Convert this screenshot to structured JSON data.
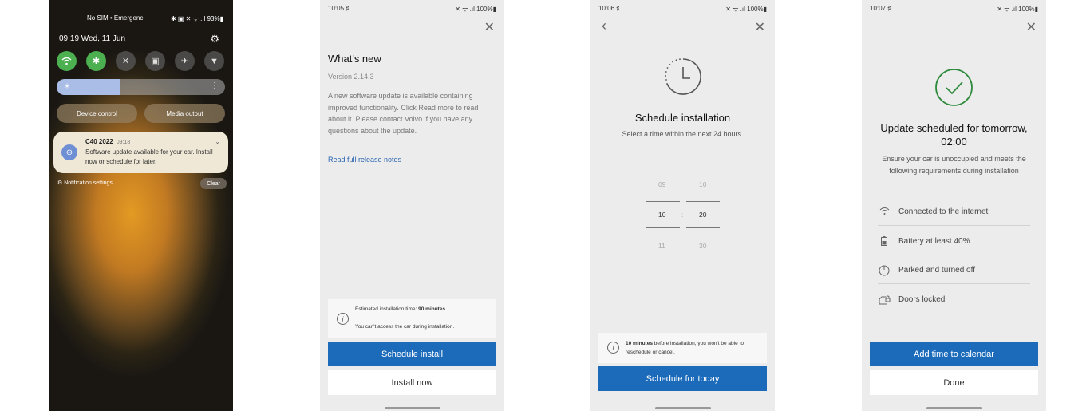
{
  "screen1": {
    "status_left": "No SIM • Emergenc",
    "status_right": "✱ ▣ ✕ ᯤ .ıl 93%▮",
    "datetime": "09:19  Wed, 11 Jun",
    "quick_tiles": [
      "wifi-icon",
      "bluetooth-icon",
      "mute-icon",
      "rotate-icon",
      "airplane-icon",
      "flashlight-icon"
    ],
    "device_control": "Device control",
    "media_output": "Media output",
    "notification": {
      "title": "C40 2022",
      "time": "09:18",
      "body": "Software update available for your car. Install now or schedule for later."
    },
    "notification_settings": "Notification settings",
    "clear": "Clear"
  },
  "screen2": {
    "status_time": "10:05 ♯",
    "status_right": "✕ ᯤ .ıl 100%▮",
    "title": "What's new",
    "version": "Version 2.14.3",
    "body": "A new software update is available containing improved functionality. Click Read more to read about it. Please contact Volvo if you have any questions about the update.",
    "link": "Read full release notes",
    "info_line1_prefix": "Estimated installation time: ",
    "info_line1_bold": "90 minutes",
    "info_line2": "You can't access the car during installation.",
    "primary_button": "Schedule install",
    "secondary_button": "Install now"
  },
  "screen3": {
    "status_time": "10:06 ♯",
    "status_right": "✕ ᯤ .ıl 100%▮",
    "title": "Schedule installation",
    "subtitle": "Select a time within the next 24 hours.",
    "hours": [
      "09",
      "10",
      "11"
    ],
    "minutes": [
      "10",
      "20",
      "30"
    ],
    "separator": ":",
    "info_bold": "10 minutes",
    "info_rest": " before installation, you won't be able to reschedule or cancel.",
    "primary_button": "Schedule for today"
  },
  "screen4": {
    "status_time": "10:07 ♯",
    "status_right": "✕ ᯤ .ıl 100%▮",
    "title_line1": "Update scheduled for tomorrow,",
    "title_line2": "02:00",
    "subtitle": "Ensure your car is unoccupied and meets the following requirements during installation",
    "requirements": [
      {
        "icon": "wifi-icon",
        "label": "Connected to the internet"
      },
      {
        "icon": "battery-icon",
        "label": "Battery at least 40%"
      },
      {
        "icon": "power-icon",
        "label": "Parked and turned off"
      },
      {
        "icon": "car-lock-icon",
        "label": "Doors locked"
      }
    ],
    "primary_button": "Add time to calendar",
    "secondary_button": "Done"
  },
  "colors": {
    "primary_blue": "#1c6bbb",
    "link_blue": "#2a64b0",
    "success_green": "#2e8b3d",
    "tile_on_green": "#4caf50"
  }
}
